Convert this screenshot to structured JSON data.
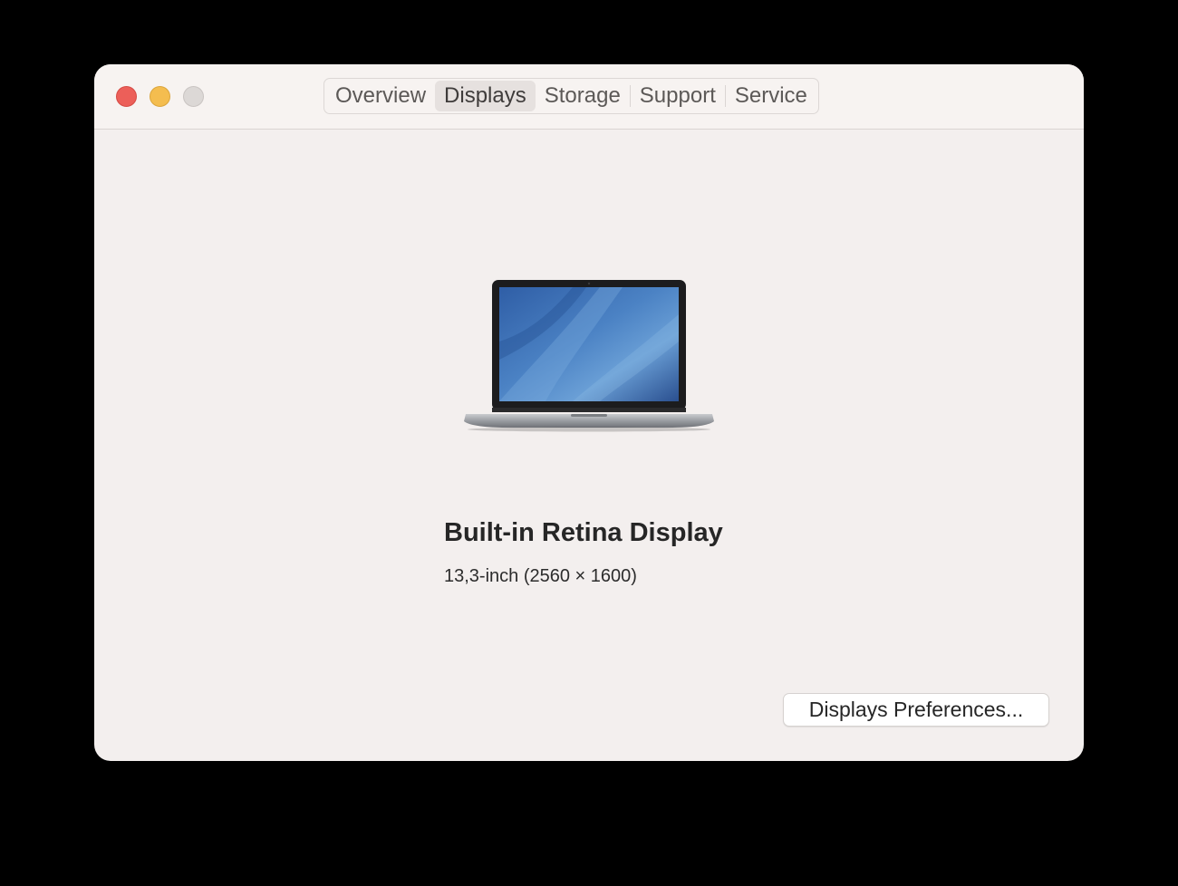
{
  "window": {
    "controls": {
      "close_color": "#ec5f59",
      "minimize_color": "#f4bd4f",
      "zoom_color": "#dcd8d6"
    }
  },
  "tabs": [
    {
      "label": "Overview",
      "active": false
    },
    {
      "label": "Displays",
      "active": true
    },
    {
      "label": "Storage",
      "active": false
    },
    {
      "label": "Support",
      "active": false
    },
    {
      "label": "Service",
      "active": false
    }
  ],
  "display": {
    "image": "macbook-pro-laptop-icon",
    "name": "Built-in Retina Display",
    "detail": "13,3-inch (2560 × 1600)"
  },
  "actions": {
    "preferences_label": "Displays Preferences..."
  }
}
